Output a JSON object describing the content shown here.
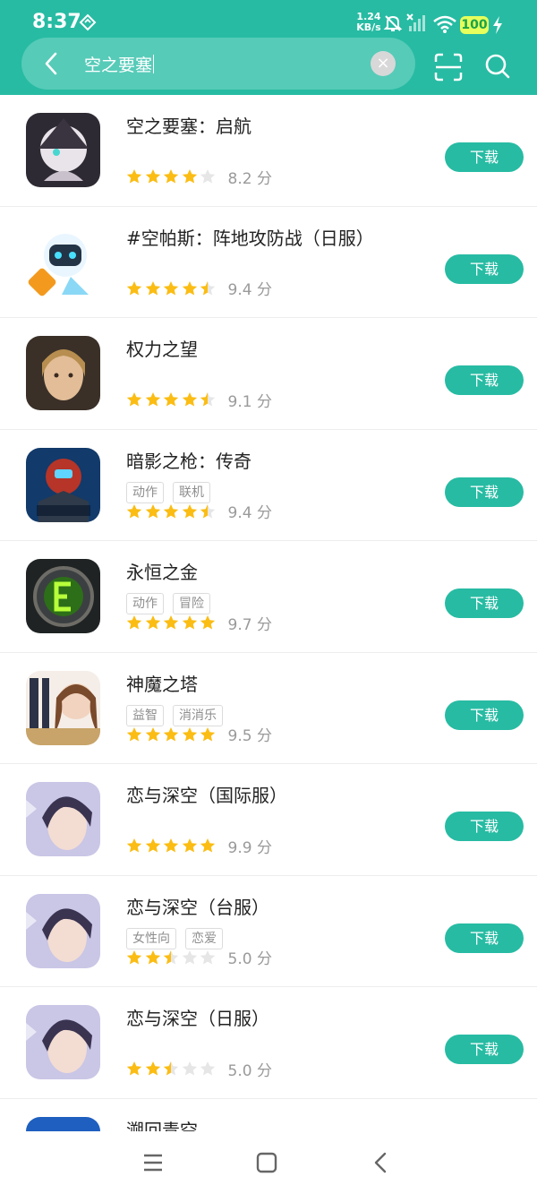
{
  "status_bar": {
    "time": "8:37",
    "net_speed_value": "1.24",
    "net_speed_unit": "KB/s",
    "battery": "100",
    "icons": [
      "location-icon",
      "mute-icon",
      "no-signal-icon",
      "wifi-icon",
      "charging-icon"
    ]
  },
  "search": {
    "query": "空之要塞",
    "clear_icon": "×",
    "icons": [
      "back-icon",
      "clear-icon",
      "scan-icon",
      "search-icon"
    ]
  },
  "colors": {
    "accent": "#27bba3",
    "star_filled": "#fbbd14",
    "star_empty": "#e6e6e6"
  },
  "download_label": "下载",
  "apps": [
    {
      "name": "空之要塞：启航",
      "tags": [],
      "rating": 4,
      "score": "8.2 分",
      "icon": "app-icon"
    },
    {
      "name": "#空帕斯：阵地攻防战（日服）",
      "tags": [],
      "rating": 4.5,
      "score": "9.4 分",
      "icon": "app-icon"
    },
    {
      "name": "权力之望",
      "tags": [],
      "rating": 4.5,
      "score": "9.1 分",
      "icon": "app-icon"
    },
    {
      "name": "暗影之枪：传奇",
      "tags": [
        "动作",
        "联机"
      ],
      "rating": 4.5,
      "score": "9.4 分",
      "icon": "app-icon"
    },
    {
      "name": "永恒之金",
      "tags": [
        "动作",
        "冒险"
      ],
      "rating": 5,
      "score": "9.7 分",
      "icon": "app-icon"
    },
    {
      "name": "神魔之塔",
      "tags": [
        "益智",
        "消消乐"
      ],
      "rating": 5,
      "score": "9.5 分",
      "icon": "app-icon"
    },
    {
      "name": "恋与深空（国际服）",
      "tags": [],
      "rating": 5,
      "score": "9.9 分",
      "icon": "app-icon"
    },
    {
      "name": "恋与深空（台服）",
      "tags": [
        "女性向",
        "恋爱"
      ],
      "rating": 2.5,
      "score": "5.0 分",
      "icon": "app-icon"
    },
    {
      "name": "恋与深空（日服）",
      "tags": [],
      "rating": 2.5,
      "score": "5.0 分",
      "icon": "app-icon"
    },
    {
      "name": "溯回青空",
      "tags": [],
      "rating": 0,
      "score": "",
      "icon": "app-icon"
    }
  ],
  "nav": [
    "menu-icon",
    "home-icon",
    "back-icon"
  ]
}
